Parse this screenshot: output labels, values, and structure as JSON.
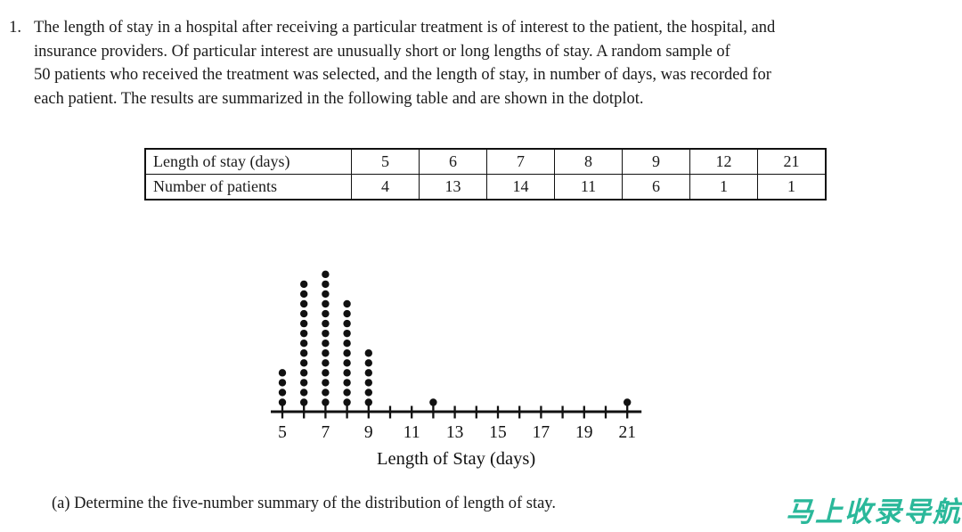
{
  "question": {
    "number": "1.",
    "lines": [
      "The length of stay in a hospital after receiving a particular treatment is of interest to the patient, the hospital, and",
      "insurance providers. Of particular interest are unusually short or long lengths of stay. A random sample of",
      "50 patients who received the treatment was selected, and the length of stay, in number of days, was recorded for",
      "each patient. The results are summarized in the following table and are shown in the dotplot."
    ]
  },
  "table": {
    "row_headers": [
      "Length of stay (days)",
      "Number of patients"
    ],
    "lengths": [
      "5",
      "6",
      "7",
      "8",
      "9",
      "12",
      "21"
    ],
    "counts": [
      "4",
      "13",
      "14",
      "11",
      "6",
      "1",
      "1"
    ]
  },
  "parts": {
    "a": "(a) Determine the five-number summary of the distribution of length of stay."
  },
  "watermark": {
    "text": "马上收录导航",
    "color": "#2ab89a"
  },
  "chart_data": {
    "type": "scatter",
    "title": "",
    "xlabel": "Length of Stay (days)",
    "ylabel": "",
    "xlim": [
      4.5,
      21.6
    ],
    "grid": false,
    "legend": "none",
    "tick_values": [
      5,
      6,
      7,
      8,
      9,
      10,
      11,
      12,
      13,
      14,
      15,
      16,
      17,
      18,
      19,
      20,
      21
    ],
    "tick_labels": [
      "5",
      "",
      "7",
      "",
      "9",
      "",
      "11",
      "",
      "13",
      "",
      "15",
      "",
      "17",
      "",
      "19",
      "",
      "21"
    ],
    "labeled_ticks": [
      5,
      7,
      9,
      11,
      13,
      15,
      17,
      19,
      21
    ],
    "categories": [
      5,
      6,
      7,
      8,
      9,
      12,
      21
    ],
    "values": [
      4,
      13,
      14,
      11,
      6,
      1,
      1
    ],
    "total_observations": 50,
    "dot_color": "#111111",
    "axis_color": "#111111"
  }
}
